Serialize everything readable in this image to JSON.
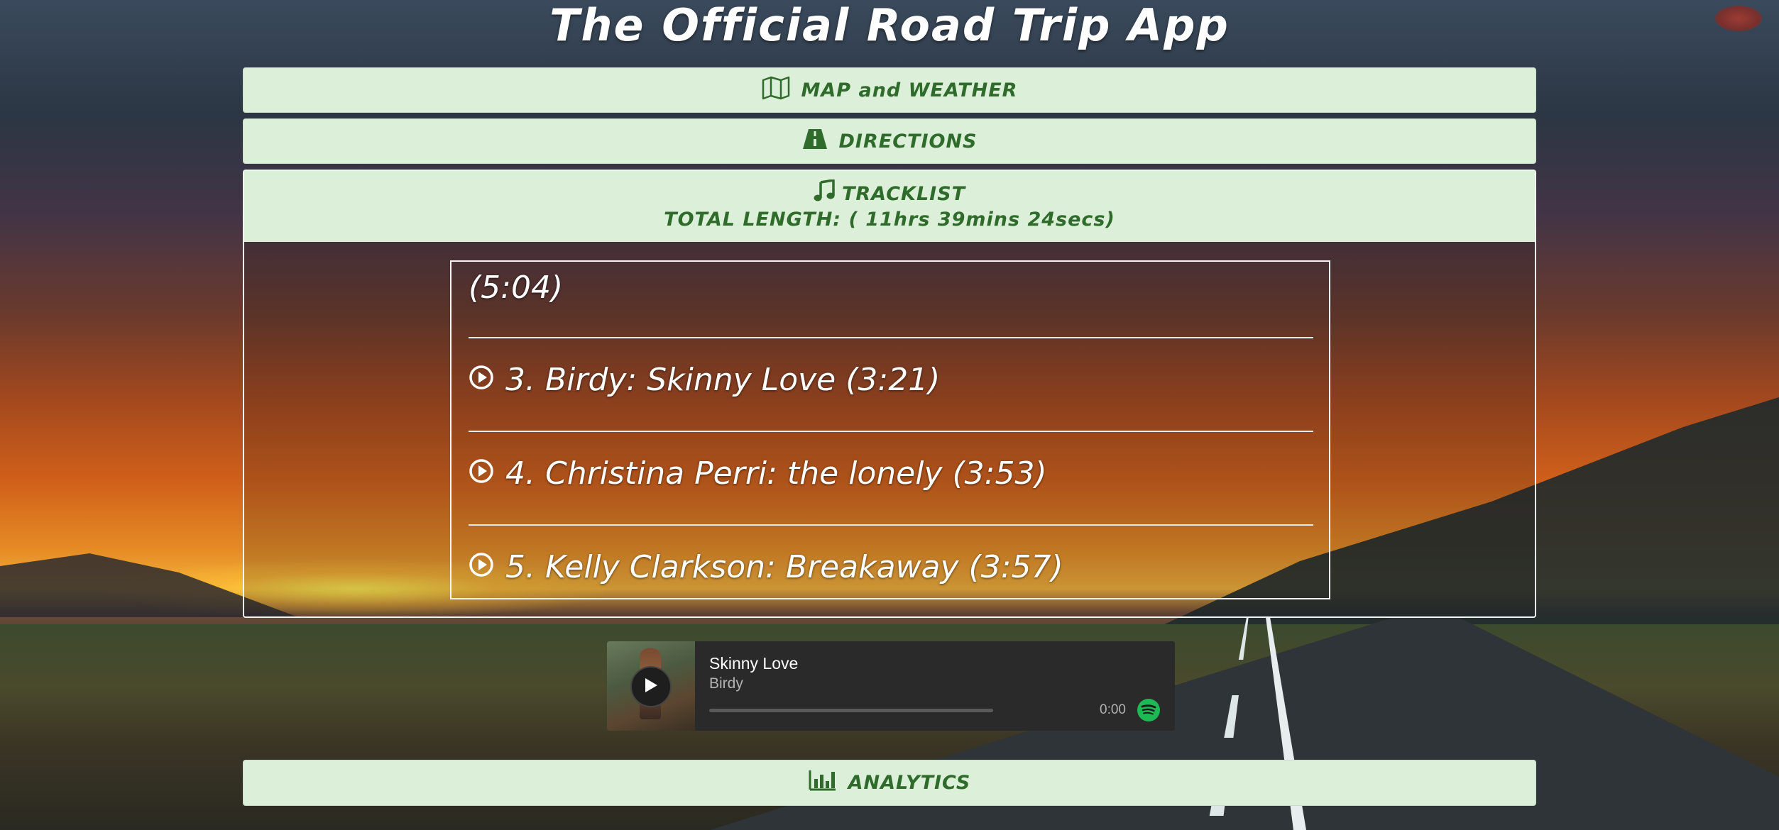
{
  "app": {
    "title": "The Official Road Trip App"
  },
  "panels": {
    "map": {
      "label": "MAP and WEATHER",
      "icon": "map-icon"
    },
    "directions": {
      "label": "DIRECTIONS",
      "icon": "road-icon"
    },
    "tracklist": {
      "label": "TRACKLIST",
      "icon": "music-note-icon",
      "total_length": "TOTAL LENGTH: ( 11hrs 39mins 24secs)"
    },
    "analytics": {
      "label": "ANALYTICS",
      "icon": "bar-chart-icon"
    }
  },
  "tracks": [
    {
      "label": "(5:04)"
    },
    {
      "label": "3. Birdy: Skinny Love (3:21)"
    },
    {
      "label": "4. Christina Perri: the lonely (3:53)"
    },
    {
      "label": "5. Kelly Clarkson: Breakaway (3:57)"
    }
  ],
  "player": {
    "song": "Skinny Love",
    "artist": "Birdy",
    "time": "0:00",
    "progress": 0,
    "brand_color": "#1db954"
  },
  "colors": {
    "panel_bg": "#dcefd9",
    "panel_text": "#2f6b2a"
  }
}
